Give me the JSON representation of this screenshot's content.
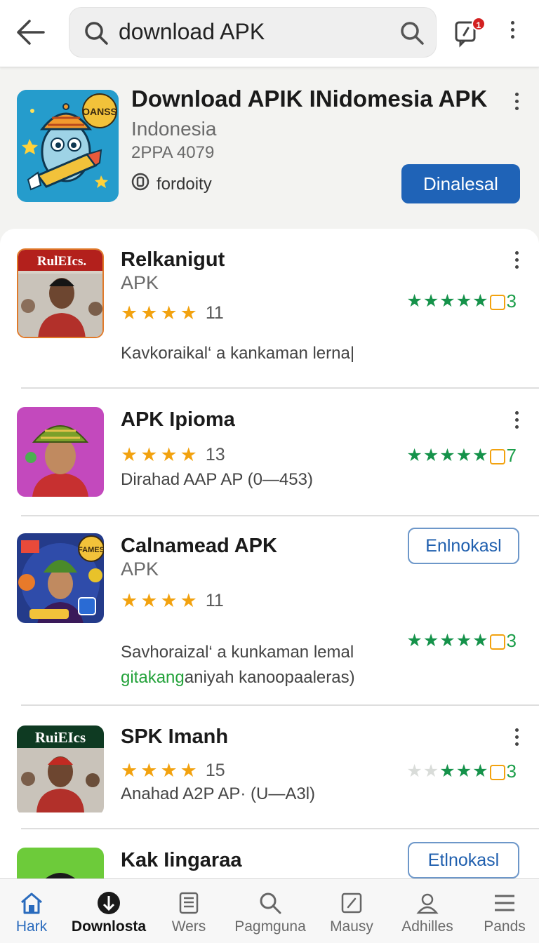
{
  "header": {
    "search_query": "download APK",
    "notification_count": "1"
  },
  "featured": {
    "title": "Download APIK INidomesia APK",
    "subtitle": "Indonesia",
    "meta": "2PPA 4079",
    "developer": "fordoity",
    "button": "Dinalesal",
    "icon_text": "OANSS"
  },
  "apps": [
    {
      "name": "Relkanigut",
      "subtitle": "APK",
      "stars": 4,
      "review_count": "11",
      "description": "Kavkoraikal‘ a kankaman lerna|",
      "right_rating": "3",
      "right_stars_full": 5,
      "icon_text": "RulEIcs."
    },
    {
      "name": "APK Ipioma",
      "stars": 4,
      "review_count": "13",
      "description": "Dirahad AAP AP (0—453)",
      "right_rating": "7",
      "right_stars_full": 5
    },
    {
      "name": "Calnamead APK",
      "subtitle": "APK",
      "stars": 4,
      "review_count": "11",
      "description": "Savhoraizal‘ a kunkaman lemal",
      "description_green": "gitakang",
      "description_rest": "aniyah kanoopaaleras)",
      "right_rating": "3",
      "right_stars_full": 5,
      "button": "Enlnokasl",
      "icon_text": "FAMES"
    },
    {
      "name": "SPK Imanh",
      "stars": 4,
      "review_count": "15",
      "description": "Anahad A2P AP·  (U—A3l)",
      "right_rating": "3",
      "right_stars_full": 3,
      "icon_text": "RuiEIcs"
    },
    {
      "name": "Kak Iingaraa",
      "button": "Etlnokasl"
    }
  ],
  "nav": [
    {
      "label": "Hark",
      "icon": "home-icon"
    },
    {
      "label": "Downlosta",
      "icon": "download-icon"
    },
    {
      "label": "Wers",
      "icon": "list-icon"
    },
    {
      "label": "Pagmguna",
      "icon": "search-icon"
    },
    {
      "label": "Mausy",
      "icon": "edit-icon"
    },
    {
      "label": "Adhilles",
      "icon": "person-icon"
    },
    {
      "label": "Pands",
      "icon": "menu-icon"
    }
  ],
  "colors": {
    "primary_button": "#1f63b7",
    "star": "#f2a20f",
    "green_rating": "#15924a",
    "active_tab": "#2a6bbd"
  }
}
